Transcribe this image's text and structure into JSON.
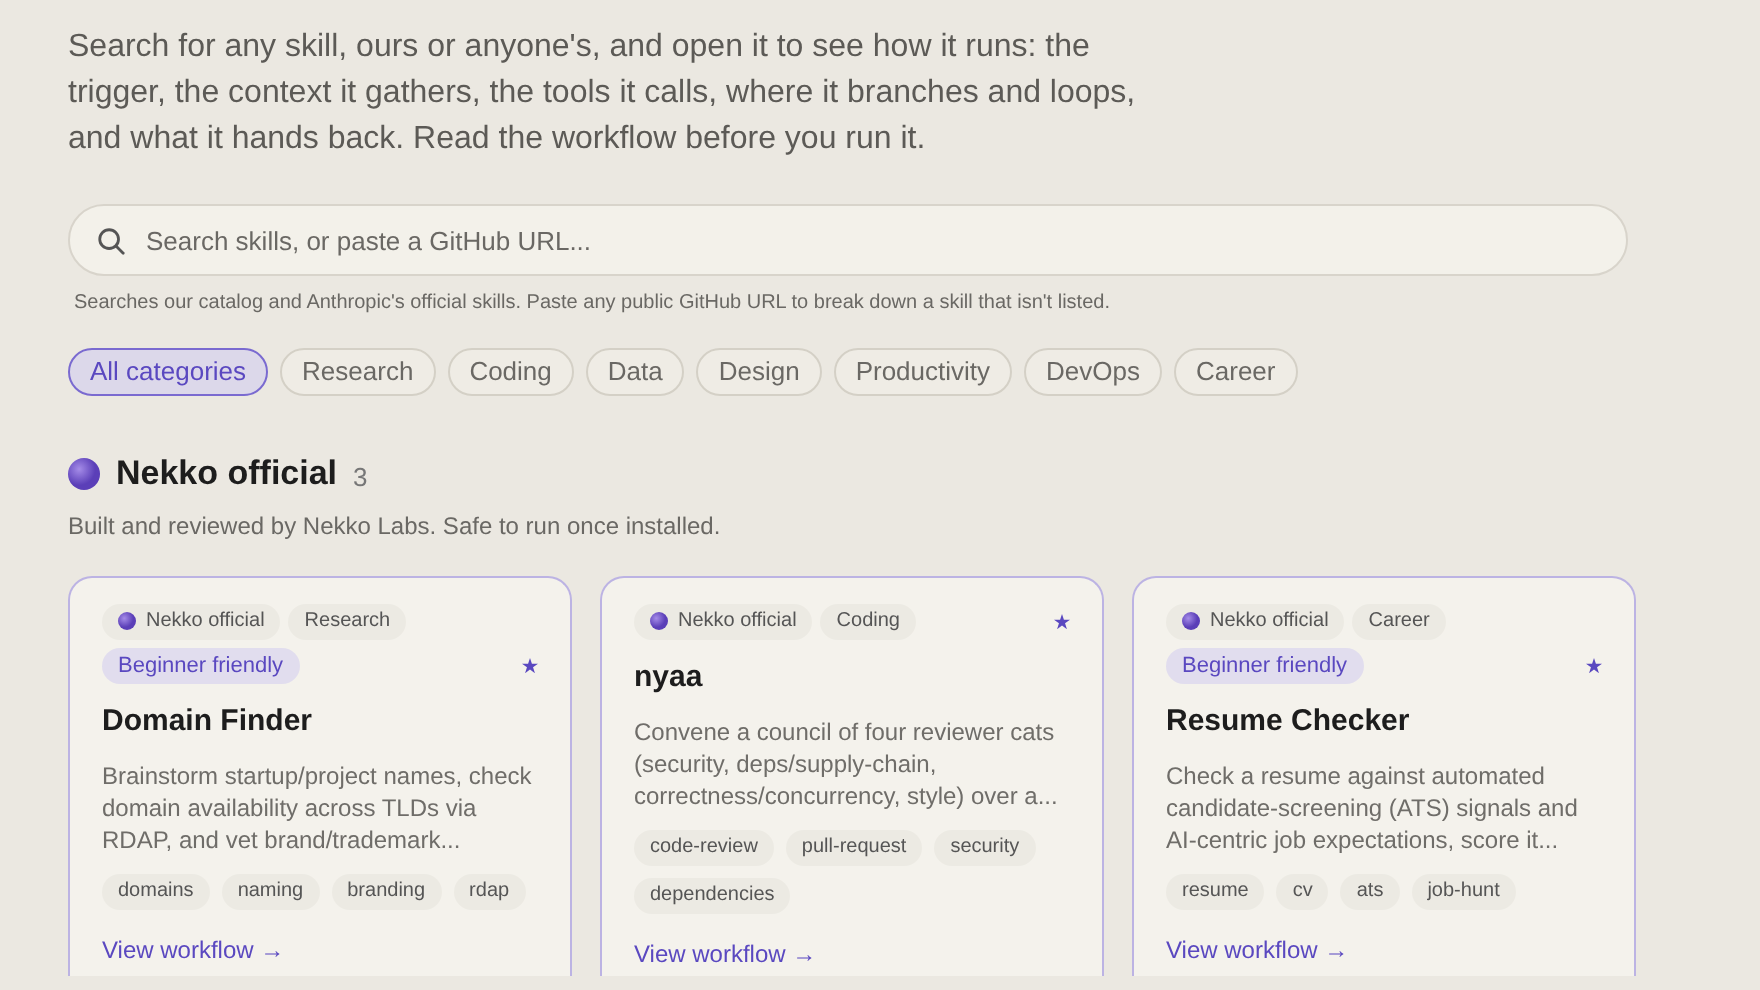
{
  "intro": "Search for any skill, ours or anyone's, and open it to see how it runs: the trigger, the context it gathers, the tools it calls, where it branches and loops, and what it hands back. Read the workflow before you run it.",
  "search": {
    "placeholder": "Search skills, or paste a GitHub URL...",
    "hint": "Searches our catalog and Anthropic's official skills. Paste any public GitHub URL to break down a skill that isn't listed."
  },
  "categories": [
    {
      "label": "All categories",
      "selected": true
    },
    {
      "label": "Research",
      "selected": false
    },
    {
      "label": "Coding",
      "selected": false
    },
    {
      "label": "Data",
      "selected": false
    },
    {
      "label": "Design",
      "selected": false
    },
    {
      "label": "Productivity",
      "selected": false
    },
    {
      "label": "DevOps",
      "selected": false
    },
    {
      "label": "Career",
      "selected": false
    }
  ],
  "section": {
    "title": "Nekko official",
    "count": "3",
    "description": "Built and reviewed by Nekko Labs. Safe to run once installed."
  },
  "cards": [
    {
      "source": "Nekko official",
      "category": "Research",
      "badge": "Beginner friendly",
      "title": "Domain Finder",
      "description": "Brainstorm startup/project names, check domain availability across TLDs via RDAP, and vet brand/trademark...",
      "tags": [
        "domains",
        "naming",
        "branding",
        "rdap"
      ],
      "link": "View workflow →"
    },
    {
      "source": "Nekko official",
      "category": "Coding",
      "title": "nyaa",
      "description": "Convene a council of four reviewer cats (security, deps/supply-chain, correctness/concurrency, style) over a...",
      "tags": [
        "code-review",
        "pull-request",
        "security",
        "dependencies"
      ],
      "link": "View workflow →"
    },
    {
      "source": "Nekko official",
      "category": "Career",
      "badge": "Beginner friendly",
      "title": "Resume Checker",
      "description": "Check a resume against automated candidate-screening (ATS) signals and AI-centric job expectations, score it...",
      "tags": [
        "resume",
        "cv",
        "ats",
        "job-hunt"
      ],
      "link": "View workflow →"
    }
  ]
}
